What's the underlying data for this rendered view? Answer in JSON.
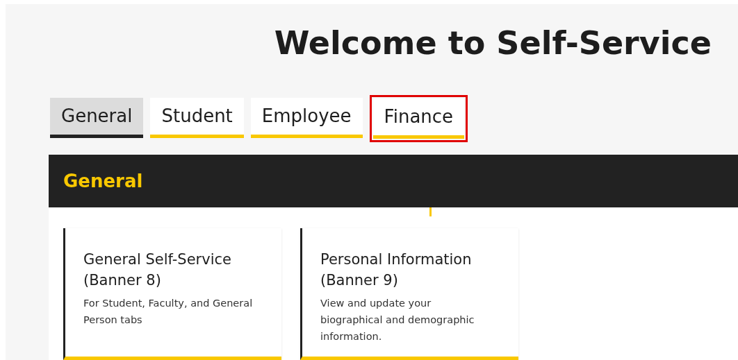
{
  "page_title": "Welcome to Self-Service",
  "tabs": [
    {
      "label": "General",
      "selected": true,
      "highlighted": false
    },
    {
      "label": "Student",
      "selected": false,
      "highlighted": false
    },
    {
      "label": "Employee",
      "selected": false,
      "highlighted": false
    },
    {
      "label": "Finance",
      "selected": false,
      "highlighted": true
    }
  ],
  "section": {
    "title": "General",
    "cards": [
      {
        "title": "General Self-Service (Banner 8)",
        "description": "For Student, Faculty, and General Person tabs"
      },
      {
        "title": "Personal Information (Banner 9)",
        "description": "View and update your biographical and demographic information."
      }
    ]
  }
}
